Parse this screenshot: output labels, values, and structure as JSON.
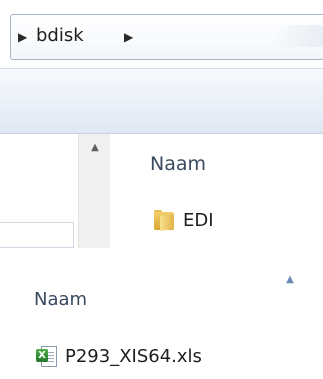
{
  "address_bar": {
    "breadcrumb": "bdisk",
    "separator_glyph": "▶"
  },
  "navigation_pane": {
    "scroll_up_glyph": "▲"
  },
  "file_list": {
    "column_header": "Naam",
    "items": [
      {
        "name": "EDI",
        "icon": "folder-icon"
      }
    ]
  },
  "file_list_2": {
    "sort_glyph": "▲",
    "column_header": "Naam",
    "items": [
      {
        "name": "P293_XIS64.xls",
        "icon": "excel-file-icon"
      }
    ]
  },
  "colors": {
    "header_text": "#3a4a5e",
    "toolbar_top": "#f8fafd",
    "toolbar_bottom": "#dfe8f2",
    "folder": "#e3b54a",
    "excel_green": "#23782a"
  }
}
